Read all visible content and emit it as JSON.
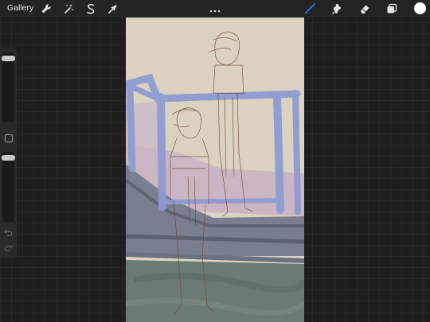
{
  "topbar": {
    "gallery_label": "Gallery",
    "tools_left": [
      "wrench-icon",
      "magic-wand-icon",
      "selection-s-icon",
      "transform-arrow-icon"
    ],
    "more_icon": "ellipsis-icon",
    "tools_right": [
      "brush-icon",
      "smudge-icon",
      "eraser-icon",
      "layers-icon"
    ],
    "current_color": "#ffffff",
    "accent_color": "#2f7cf6"
  },
  "sidebar": {
    "size_slider_level": 0.95,
    "opacity_slider_level": 0.95,
    "modify_icon": "square-button-icon",
    "undo_icon": "undo-arrow-icon",
    "redo_icon": "redo-arrow-icon"
  },
  "canvas": {
    "background_color": "#dbd2bf",
    "paint_colors": [
      "#8e9ad0",
      "#c9b3c6",
      "#6e7688",
      "#5e6e6a",
      "#6e4b3c"
    ]
  }
}
